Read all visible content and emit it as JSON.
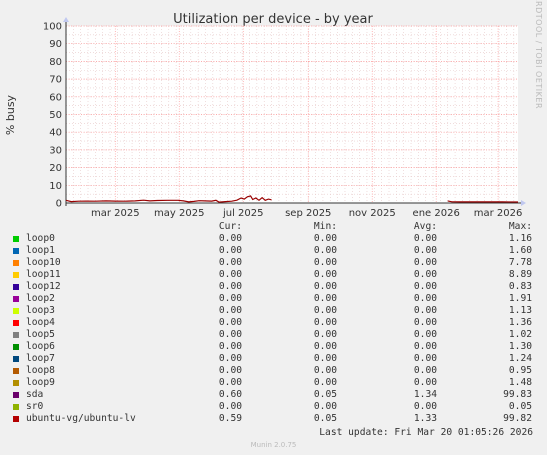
{
  "chart_data": {
    "type": "line",
    "title": "Utilization per device - by year",
    "ylabel": "% busy",
    "side_label": "RRDTOOL / TOBI OETIKER",
    "ylim": [
      0,
      100
    ],
    "yticks": [
      0,
      10,
      20,
      30,
      40,
      50,
      60,
      70,
      80,
      90,
      100
    ],
    "xlim": [
      "2025-01-13",
      "2026-03-20"
    ],
    "xticks": [
      {
        "label": "mar 2025",
        "date": "2025-03-01"
      },
      {
        "label": "may 2025",
        "date": "2025-05-01"
      },
      {
        "label": "jul 2025",
        "date": "2025-07-01"
      },
      {
        "label": "sep 2025",
        "date": "2025-09-01"
      },
      {
        "label": "nov 2025",
        "date": "2025-11-01"
      },
      {
        "label": "ene 2026",
        "date": "2026-01-01"
      },
      {
        "label": "mar 2026",
        "date": "2026-03-01"
      }
    ],
    "series_color": "#990000",
    "series": [
      {
        "name": "ubuntu-vg/ubuntu-lv",
        "points": [
          [
            "2025-01-13",
            1.5
          ],
          [
            "2025-01-18",
            0.8
          ],
          [
            "2025-01-25",
            1.0
          ],
          [
            "2025-02-01",
            1.1
          ],
          [
            "2025-02-10",
            1.0
          ],
          [
            "2025-02-20",
            1.2
          ],
          [
            "2025-03-01",
            1.1
          ],
          [
            "2025-03-10",
            1.0
          ],
          [
            "2025-03-20",
            1.2
          ],
          [
            "2025-03-28",
            1.6
          ],
          [
            "2025-04-03",
            1.2
          ],
          [
            "2025-04-10",
            1.4
          ],
          [
            "2025-04-20",
            1.5
          ],
          [
            "2025-04-30",
            1.5
          ],
          [
            "2025-05-05",
            1.2
          ],
          [
            "2025-05-10",
            0.6
          ],
          [
            "2025-05-15",
            0.9
          ],
          [
            "2025-05-20",
            1.3
          ],
          [
            "2025-05-25",
            1.2
          ],
          [
            "2025-06-01",
            1.1
          ],
          [
            "2025-06-05",
            1.5
          ],
          [
            "2025-06-08",
            0.5
          ],
          [
            "2025-06-14",
            0.8
          ],
          [
            "2025-06-20",
            1.0
          ],
          [
            "2025-06-25",
            1.6
          ],
          [
            "2025-06-29",
            2.8
          ],
          [
            "2025-07-02",
            2.2
          ],
          [
            "2025-07-05",
            3.5
          ],
          [
            "2025-07-08",
            4.0
          ],
          [
            "2025-07-10",
            2.0
          ],
          [
            "2025-07-13",
            2.8
          ],
          [
            "2025-07-16",
            1.5
          ],
          [
            "2025-07-19",
            3.0
          ],
          [
            "2025-07-22",
            1.5
          ],
          [
            "2025-07-25",
            2.2
          ],
          [
            "2025-07-28",
            1.8
          ],
          [
            "2025-07-31",
            null
          ],
          [
            "2026-01-11",
            null
          ],
          [
            "2026-01-12",
            1.2
          ],
          [
            "2026-01-16",
            0.7
          ],
          [
            "2026-01-24",
            0.6
          ],
          [
            "2026-02-05",
            0.6
          ],
          [
            "2026-02-20",
            0.6
          ],
          [
            "2026-03-05",
            0.6
          ],
          [
            "2026-03-20",
            0.59
          ]
        ]
      }
    ]
  },
  "legend": {
    "headers": {
      "cur": "Cur:",
      "min": "Min:",
      "avg": "Avg:",
      "max": "Max:"
    },
    "rows": [
      {
        "name": "loop0",
        "color": "#00cc00",
        "cur": "0.00",
        "min": "0.00",
        "avg": "0.00",
        "max": "1.16"
      },
      {
        "name": "loop1",
        "color": "#0066b3",
        "cur": "0.00",
        "min": "0.00",
        "avg": "0.00",
        "max": "1.60"
      },
      {
        "name": "loop10",
        "color": "#ff8000",
        "cur": "0.00",
        "min": "0.00",
        "avg": "0.00",
        "max": "7.78"
      },
      {
        "name": "loop11",
        "color": "#ffcc00",
        "cur": "0.00",
        "min": "0.00",
        "avg": "0.00",
        "max": "8.89"
      },
      {
        "name": "loop12",
        "color": "#330099",
        "cur": "0.00",
        "min": "0.00",
        "avg": "0.00",
        "max": "0.83"
      },
      {
        "name": "loop2",
        "color": "#990099",
        "cur": "0.00",
        "min": "0.00",
        "avg": "0.00",
        "max": "1.91"
      },
      {
        "name": "loop3",
        "color": "#ccff00",
        "cur": "0.00",
        "min": "0.00",
        "avg": "0.00",
        "max": "1.13"
      },
      {
        "name": "loop4",
        "color": "#ff0000",
        "cur": "0.00",
        "min": "0.00",
        "avg": "0.00",
        "max": "1.36"
      },
      {
        "name": "loop5",
        "color": "#808080",
        "cur": "0.00",
        "min": "0.00",
        "avg": "0.00",
        "max": "1.02"
      },
      {
        "name": "loop6",
        "color": "#008f00",
        "cur": "0.00",
        "min": "0.00",
        "avg": "0.00",
        "max": "1.30"
      },
      {
        "name": "loop7",
        "color": "#00487d",
        "cur": "0.00",
        "min": "0.00",
        "avg": "0.00",
        "max": "1.24"
      },
      {
        "name": "loop8",
        "color": "#b35a00",
        "cur": "0.00",
        "min": "0.00",
        "avg": "0.00",
        "max": "0.95"
      },
      {
        "name": "loop9",
        "color": "#b38f00",
        "cur": "0.00",
        "min": "0.00",
        "avg": "0.00",
        "max": "1.48"
      },
      {
        "name": "sda",
        "color": "#6b006b",
        "cur": "0.60",
        "min": "0.05",
        "avg": "1.34",
        "max": "99.83"
      },
      {
        "name": "sr0",
        "color": "#8fb300",
        "cur": "0.00",
        "min": "0.00",
        "avg": "0.00",
        "max": "0.05"
      },
      {
        "name": "ubuntu-vg/ubuntu-lv",
        "color": "#b30000",
        "cur": "0.59",
        "min": "0.05",
        "avg": "1.33",
        "max": "99.82"
      }
    ]
  },
  "last_update": "Last update: Fri Mar 20 01:05:26 2026",
  "footer": "Munin 2.0.75"
}
